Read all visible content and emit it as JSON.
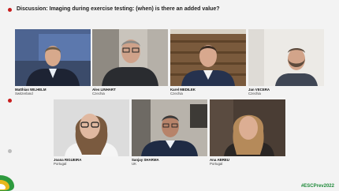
{
  "header": {
    "title": "Discussion: Imaging during exercise testing: (when) is there an added value?"
  },
  "participants": [
    {
      "name": "Matthias WILHELM",
      "country": "Switzerland"
    },
    {
      "name": "Ales LINHART",
      "country": "Czechia"
    },
    {
      "name": "Karel MEDILEK",
      "country": "Czechia"
    },
    {
      "name": "Jan VECERA",
      "country": "Czechia"
    },
    {
      "name": "Joana RIGUEIRA",
      "country": "Portugal"
    },
    {
      "name": "Sanjay SHARMA",
      "country": "UK"
    },
    {
      "name": "Ana ABREU",
      "country": "Portugal"
    }
  ],
  "footer": {
    "hashtag": "#ESCPrev2022"
  },
  "colors": {
    "accent_red": "#c81e1e",
    "hashtag_green": "#1f8a3a",
    "logo_green": "#2e9a3e",
    "logo_yellow": "#e8b81d"
  }
}
